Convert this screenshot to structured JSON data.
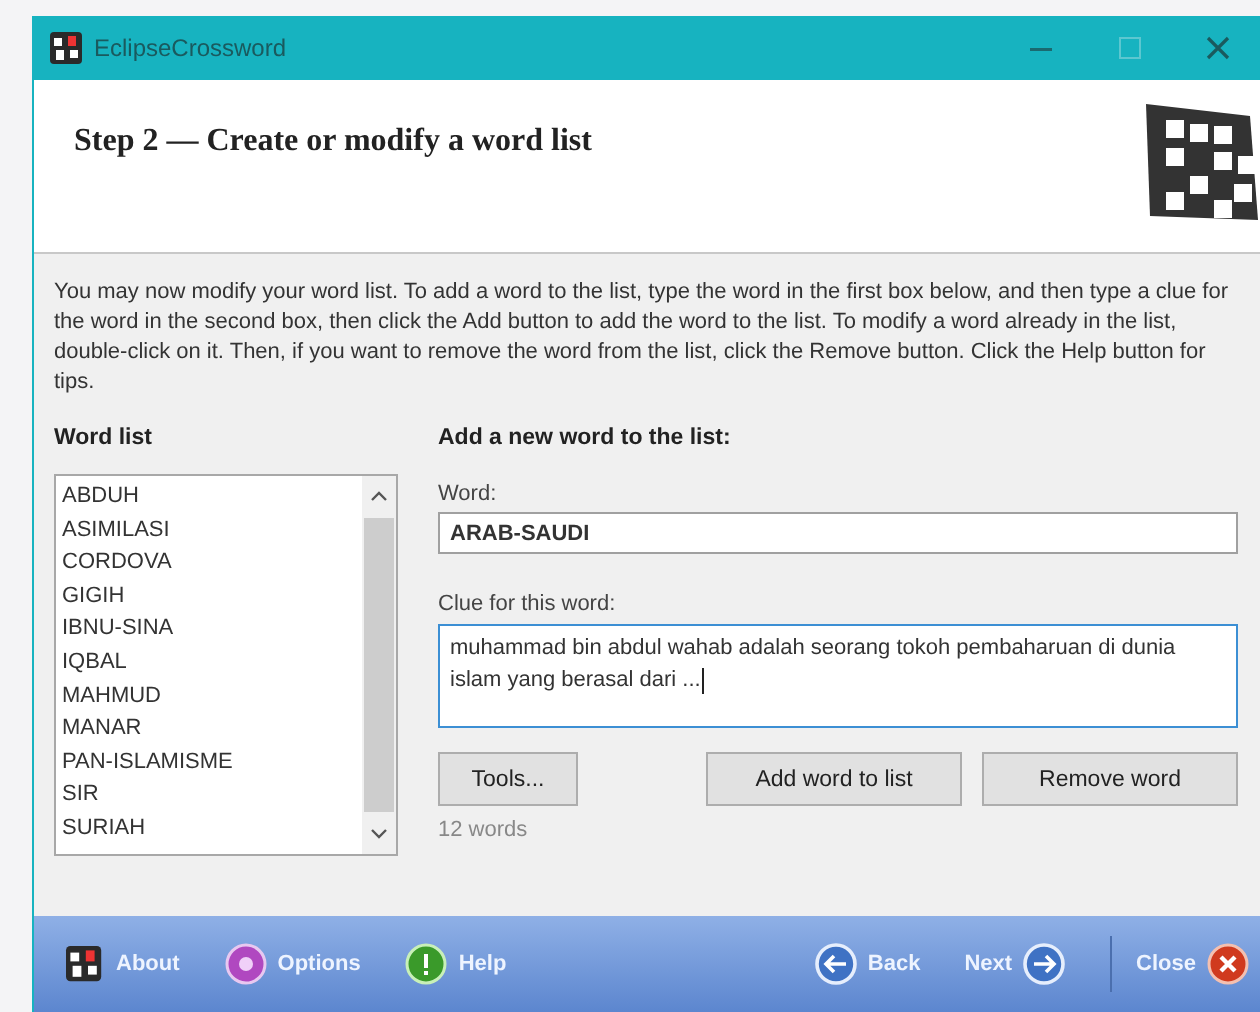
{
  "window": {
    "title": "EclipseCrossword"
  },
  "header": {
    "title": "Step 2 — Create or modify a word list"
  },
  "instructions": "You may now modify your word list.  To add a word to the list, type the word in the first box below, and then type a clue for the word in the second box, then click the Add button to add the word to the list.  To modify a word already in the list, double-click on it.  Then, if you want to remove the word from the list, click the Remove button.  Click the Help button for tips.",
  "word_list": {
    "label": "Word list",
    "items": [
      "ABDUH",
      "ASIMILASI",
      "CORDOVA",
      "GIGIH",
      "IBNU-SINA",
      "IQBAL",
      "MAHMUD",
      "MANAR",
      "PAN-ISLAMISME",
      "SIR",
      "SURIAH"
    ]
  },
  "add_panel": {
    "heading": "Add a new word to the list:",
    "word_label": "Word:",
    "word_value": "ARAB-SAUDI",
    "clue_label": "Clue for this word:",
    "clue_value": "muhammad bin abdul wahab adalah seorang tokoh pembaharuan di dunia islam yang berasal dari ...",
    "tools_button": "Tools...",
    "add_button": "Add word to list",
    "remove_button": "Remove word",
    "count": "12 words"
  },
  "footer": {
    "buttons": [
      {
        "label": "About",
        "kind": "about"
      },
      {
        "label": "Options",
        "kind": "options"
      },
      {
        "label": "Help",
        "kind": "help"
      },
      {
        "label": "Back",
        "kind": "back"
      },
      {
        "label": "Next",
        "kind": "next"
      },
      {
        "label": "Close",
        "kind": "close"
      }
    ]
  }
}
